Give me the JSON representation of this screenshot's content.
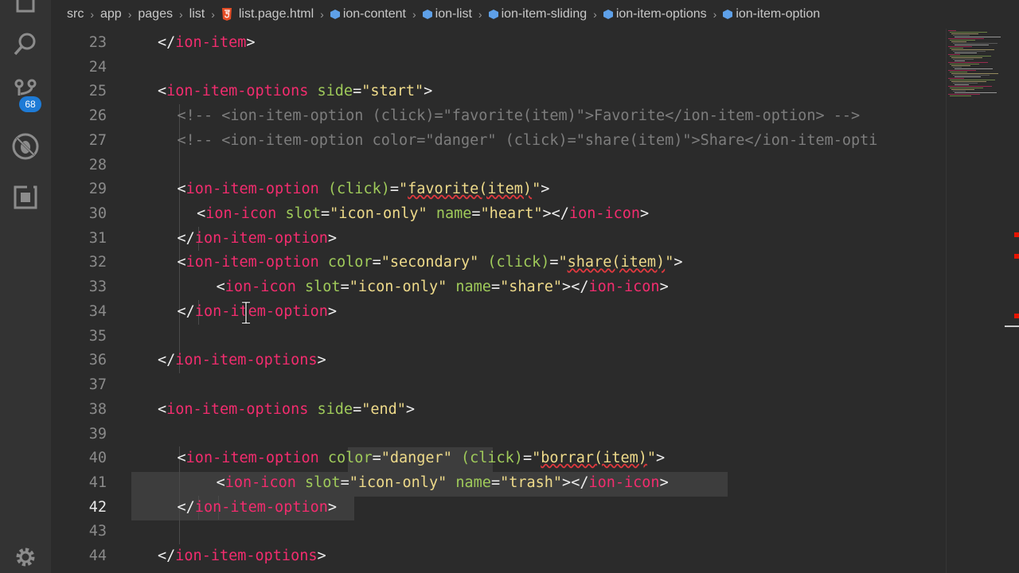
{
  "activity_bar": {
    "source_control_badge": "68",
    "icons": [
      "explorer-icon",
      "search-icon",
      "source-control-icon",
      "debug-icon",
      "extensions-icon",
      "settings-gear-icon"
    ]
  },
  "breadcrumbs": {
    "items": [
      "src",
      "app",
      "pages",
      "list",
      "list.page.html",
      "ion-content",
      "ion-list",
      "ion-item-sliding",
      "ion-item-options",
      "ion-item-option"
    ]
  },
  "editor": {
    "active_line": "42",
    "lines": [
      {
        "n": "23",
        "text": "</ion-item>"
      },
      {
        "n": "24",
        "text": ""
      },
      {
        "n": "25",
        "text": "<ion-item-options side=\"start\">"
      },
      {
        "n": "26",
        "text": "<!-- <ion-item-option (click)=\"favorite(item)\">Favorite</ion-item-option> -->"
      },
      {
        "n": "27",
        "text": "<!-- <ion-item-option color=\"danger\" (click)=\"share(item)\">Share</ion-item-opti"
      },
      {
        "n": "28",
        "text": ""
      },
      {
        "n": "29",
        "text": "<ion-item-option (click)=\"favorite(item)\">"
      },
      {
        "n": "30",
        "text": "<ion-icon slot=\"icon-only\" name=\"heart\"></ion-icon>"
      },
      {
        "n": "31",
        "text": "</ion-item-option>"
      },
      {
        "n": "32",
        "text": "<ion-item-option color=\"secondary\" (click)=\"share(item)\">"
      },
      {
        "n": "33",
        "text": "<ion-icon slot=\"icon-only\" name=\"share\"></ion-icon>"
      },
      {
        "n": "34",
        "text": "</ion-item-option>"
      },
      {
        "n": "35",
        "text": ""
      },
      {
        "n": "36",
        "text": "</ion-item-options>"
      },
      {
        "n": "37",
        "text": ""
      },
      {
        "n": "38",
        "text": "<ion-item-options side=\"end\">"
      },
      {
        "n": "39",
        "text": ""
      },
      {
        "n": "40",
        "text": "<ion-item-option color=\"danger\" (click)=\"borrar(item)\">"
      },
      {
        "n": "41",
        "text": "<ion-icon slot=\"icon-only\" name=\"trash\"></ion-icon>"
      },
      {
        "n": "42",
        "text": "</ion-item-option>"
      },
      {
        "n": "43",
        "text": ""
      },
      {
        "n": "44",
        "text": "</ion-item-options>"
      }
    ]
  },
  "colors": {
    "background": "#2b2b2b",
    "tag": "#f22c6e",
    "attribute": "#9fca5a",
    "string": "#eeda8a",
    "comment": "#7d7d7d",
    "badge": "#1e7bd6",
    "error": "#e51400"
  }
}
